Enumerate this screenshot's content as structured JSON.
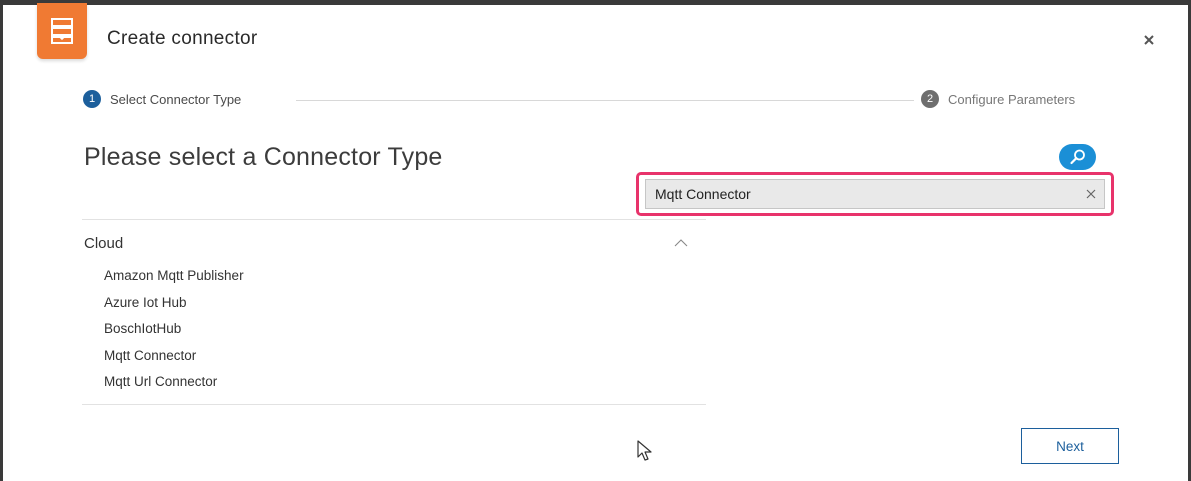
{
  "dialog": {
    "title": "Create connector",
    "app_icon": "server-stack-icon",
    "close_icon": "close-icon"
  },
  "steps": [
    {
      "number": "1",
      "label": "Select Connector Type",
      "state": "active"
    },
    {
      "number": "2",
      "label": "Configure Parameters",
      "state": "inactive"
    }
  ],
  "heading": "Please select a Connector Type",
  "search": {
    "value": "Mqtt Connector",
    "placeholder": "",
    "toggle_icon": "search-icon",
    "clear_icon": "clear-icon"
  },
  "categories": [
    {
      "name": "Cloud",
      "expanded": true,
      "items": [
        "Amazon Mqtt Publisher",
        "Azure Iot Hub",
        "BoschIotHub",
        "Mqtt Connector",
        "Mqtt Url Connector"
      ]
    }
  ],
  "footer": {
    "next_label": "Next"
  },
  "colors": {
    "accent": "#1c5f9c",
    "brand": "#f07a33",
    "search_toggle": "#1b8fd6",
    "highlight": "#e8336b"
  }
}
